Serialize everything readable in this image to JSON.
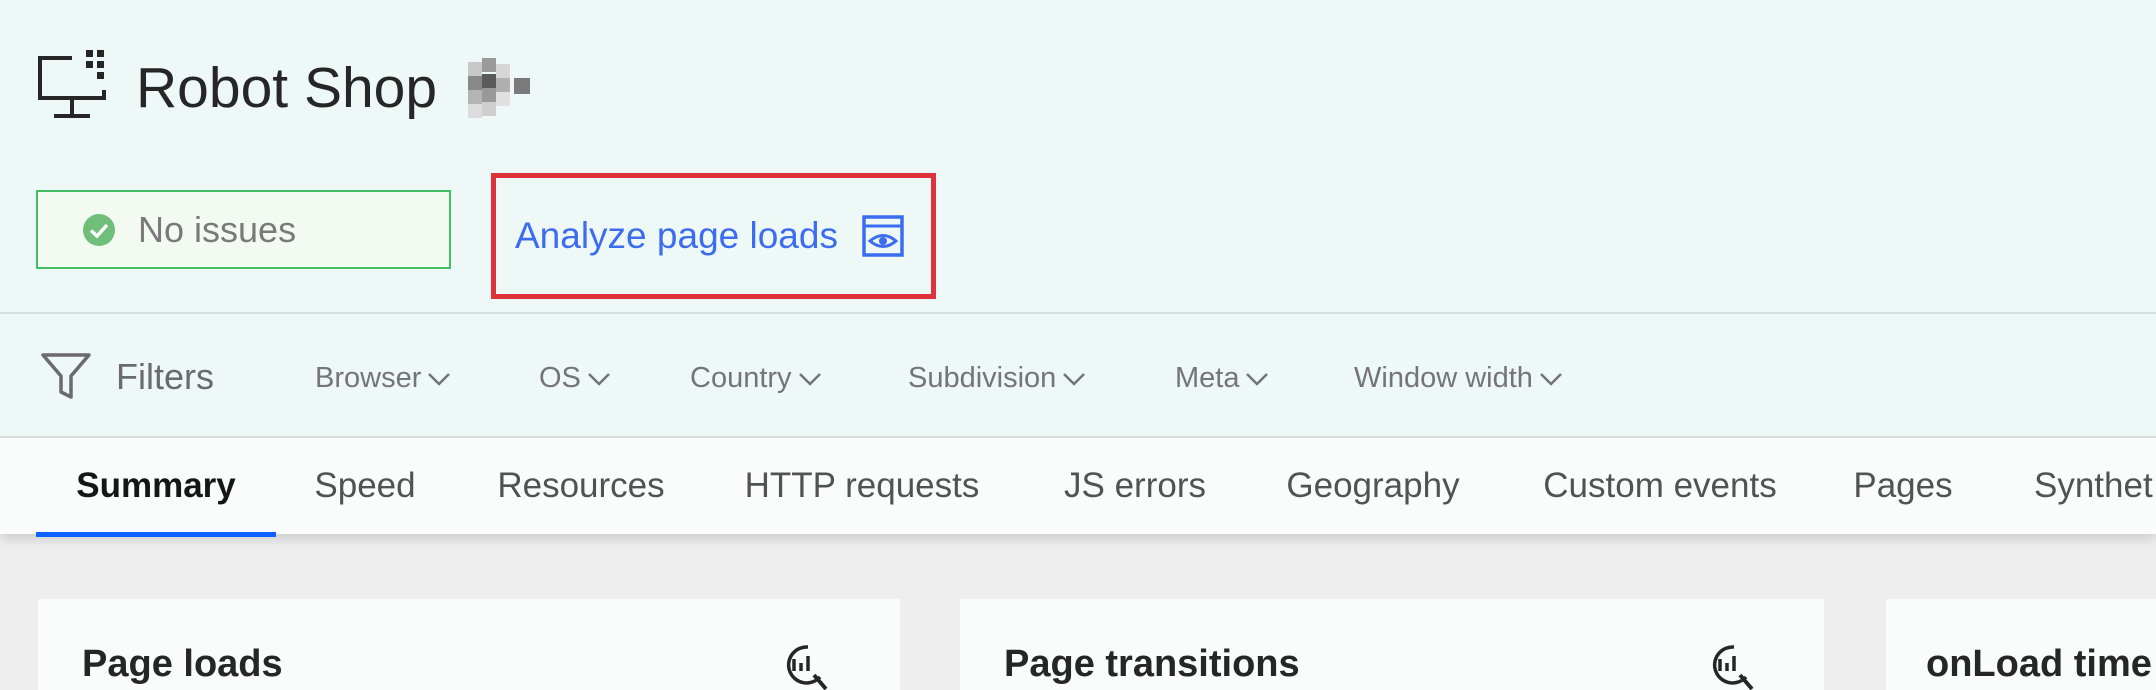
{
  "app": {
    "title": "Robot Shop"
  },
  "status": {
    "label": "No issues",
    "color": "#42be65"
  },
  "analyze": {
    "label": "Analyze page loads",
    "icon": "eye-icon"
  },
  "filters": {
    "label": "Filters",
    "items": [
      "Browser",
      "OS",
      "Country",
      "Subdivision",
      "Meta",
      "Window width"
    ]
  },
  "tabs": {
    "active": "Summary",
    "items": [
      "Summary",
      "Speed",
      "Resources",
      "HTTP requests",
      "JS errors",
      "Geography",
      "Custom events",
      "Pages",
      "Synthet"
    ]
  },
  "cards": [
    {
      "title": "Page loads"
    },
    {
      "title": "Page transitions"
    },
    {
      "title": "onLoad time"
    }
  ],
  "colors": {
    "accent": "#0f62fe",
    "link": "#3c6df0",
    "highlight": "#e0323a"
  }
}
